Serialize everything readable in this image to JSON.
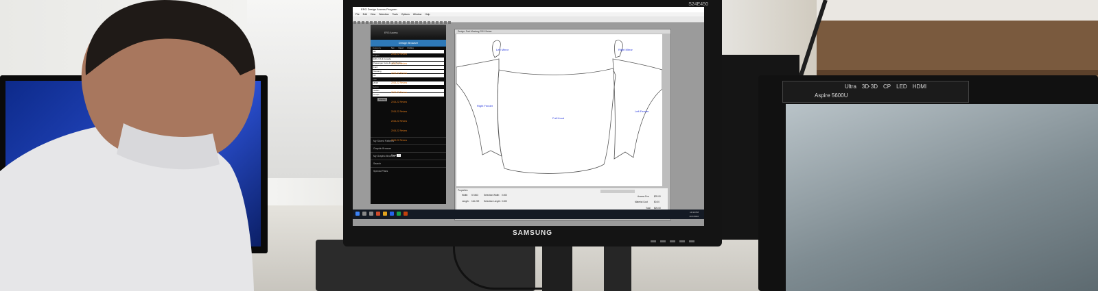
{
  "app": {
    "title": "ERG Design Access Program",
    "menu": [
      "File",
      "Edit",
      "View",
      "Selection",
      "Tools",
      "Options",
      "Window",
      "Help"
    ]
  },
  "monitor": {
    "brand": "SAMSUNG",
    "model": "S24E450"
  },
  "right_monitor": {
    "model": "Aspire 5600U",
    "badges": [
      "Ultra",
      "3D·3D",
      "CP",
      "LED",
      "HDMI"
    ]
  },
  "browser": {
    "title": "ERG Access",
    "tab": "Design Browser",
    "fields": [
      {
        "label": "Category",
        "value": "All"
      },
      {
        "label": "Region",
        "value": "ERG US & Canada"
      },
      {
        "label": "",
        "value": "Passenger Cars & Light Trucks"
      },
      {
        "label": "",
        "value": "Ford"
      },
      {
        "label": "",
        "value": "Mustang"
      },
      {
        "label": "",
        "value": "All"
      },
      {
        "label": "Year",
        "value": "2015"
      },
      {
        "label": "Sedan",
        "value": "Sedan"
      },
      {
        "label": "",
        "value": "Coupe"
      }
    ],
    "display_button": "Display",
    "sections": [
      "My Stored Patterns",
      "Graphic Browser",
      "My Graphic Browser",
      "Search",
      "Special Plans"
    ],
    "list_header": [
      "Set",
      "Used",
      "Rolling"
    ],
    "list_rows": [
      "2015-22  Review",
      "2015-22  Review",
      "2015-22  Review",
      "2015-22  Review",
      "2015-22  Review",
      "2015-22  Review",
      "2015-22  Review",
      "2015-22  Review",
      "2015-22  Review",
      "2015-22  Review"
    ],
    "pager_label": "Page",
    "pager_value": "1"
  },
  "viewer": {
    "title": "Design: Ford Mustang 2015 Sedan",
    "pieces": {
      "left_mirror": "Left Mirror",
      "right_mirror": "Right Mirror",
      "right_fender": "Right Fender",
      "left_fender": "Left Fender",
      "full_hood": "Full Hood"
    }
  },
  "properties": {
    "header": "Properties",
    "width_label": "Width:",
    "width_value": "57.863",
    "length_label": "Length:",
    "length_value": "116.229",
    "sel_width_label": "Selection Width:",
    "sel_width_value": "0.000",
    "sel_length_label": "Selection Length:",
    "sel_length_value": "0.000",
    "access_fee_label": "Access Fee",
    "access_fee_value": "$25.00",
    "material_cost_label": "Material Cost",
    "material_cost_value": "$0.00",
    "total_label": "Total",
    "total_value": "$25.00"
  },
  "taskbar": {
    "time": "10:12 PM",
    "date": "2/17/2016"
  }
}
